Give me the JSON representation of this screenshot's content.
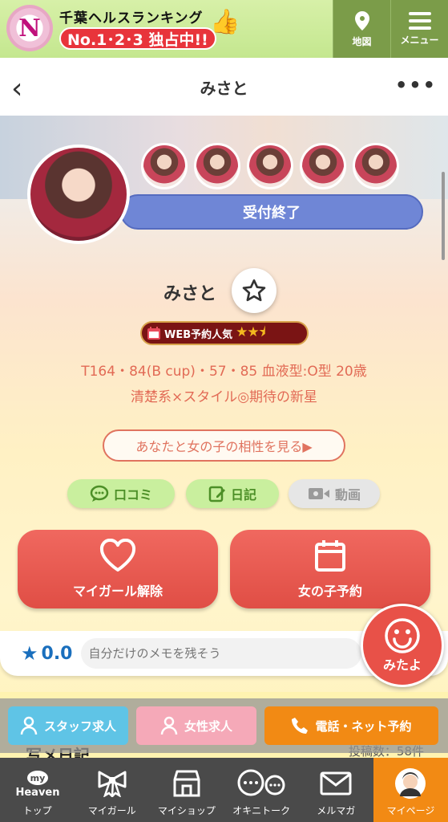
{
  "banner": {
    "logo_letter": "N",
    "line1": "千葉ヘルスランキング",
    "line2": "No.1･2･3 独占中!!",
    "map_label": "地図",
    "menu_label": "メニュー"
  },
  "header": {
    "title": "みさと",
    "back_glyph": "‹",
    "more_glyph": "•••"
  },
  "status": "受付終了",
  "profile": {
    "name": "みさと",
    "web_badge": "WEB予約人気",
    "web_stars": "★★⯨",
    "stats": "T164・84(B cup)・57・85  血液型:O型  20歳",
    "catchphrase": "清楚系×スタイル◎期待の新星",
    "compat_button": "あなたと女の子の相性を見る▶"
  },
  "pills": {
    "reviews": "口コミ",
    "diary": "日記",
    "video": "動画"
  },
  "actions": {
    "mygirl_remove": "マイガール解除",
    "reserve": "女の子予約"
  },
  "memo": {
    "rating": "0.0",
    "placeholder": "自分だけのメモを残そう"
  },
  "mitayo_label": "みたよ",
  "diary_section": {
    "title": "写メ日記",
    "count": "投稿数：58件"
  },
  "cta": {
    "staff": "スタッフ求人",
    "female": "女性求人",
    "reserve": "電話・ネット予約"
  },
  "tabs": [
    {
      "label": "トップ",
      "icon_text": "my Heaven"
    },
    {
      "label": "マイガール"
    },
    {
      "label": "マイショップ"
    },
    {
      "label": "オキニトーク"
    },
    {
      "label": "メルマガ"
    },
    {
      "label": "マイページ"
    }
  ],
  "colors": {
    "banner_green": "#cdeb9e",
    "status_blue": "#6f86d6",
    "accent_red": "#e04e45",
    "pill_green": "#c9ef9e",
    "cta_orange": "#f28a14",
    "cta_blue": "#5fc4e6",
    "cta_pink": "#f5a9b8",
    "tabbar_grey": "#4a4a4a"
  }
}
